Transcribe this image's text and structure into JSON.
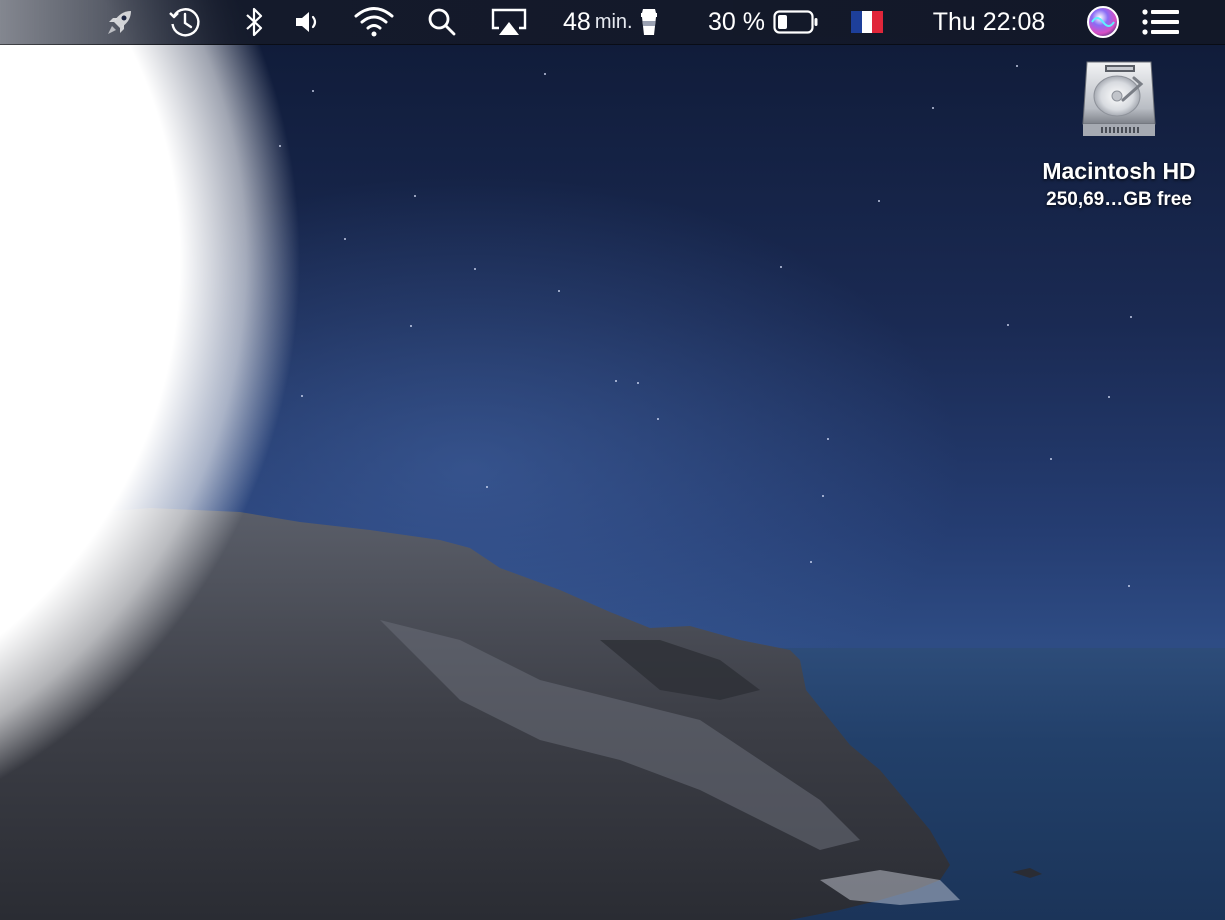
{
  "menubar": {
    "items": [
      {
        "name": "rocket-icon"
      },
      {
        "name": "time-machine-icon"
      },
      {
        "name": "bluetooth-icon"
      },
      {
        "name": "volume-icon"
      },
      {
        "name": "wifi-icon"
      },
      {
        "name": "search-icon"
      },
      {
        "name": "airplay-icon"
      }
    ],
    "timer": {
      "value": "48",
      "unit": "min.",
      "icon": "coffee-cup-icon"
    },
    "battery": {
      "percent_label": "30 %",
      "level": 0.3,
      "icon": "battery-icon"
    },
    "input_source": {
      "icon": "french-flag-icon",
      "colors": [
        "#1d3f9a",
        "#ffffff",
        "#e0263a"
      ]
    },
    "clock": "Thu 22:08",
    "siri_icon": "siri-icon",
    "notification_icon": "notification-center-icon"
  },
  "desktop": {
    "disk": {
      "name": "Macintosh HD",
      "free": "250,69…GB free",
      "icon": "hard-drive-icon"
    }
  }
}
